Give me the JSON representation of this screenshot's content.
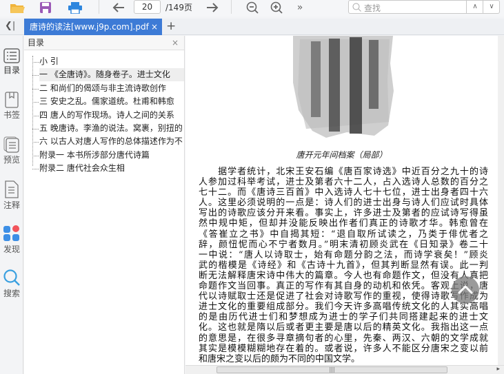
{
  "toolbar": {
    "page_current": "20",
    "page_total": "/149页",
    "search_placeholder": "查找",
    "more": "»"
  },
  "tab": {
    "title": "唐诗的读法[www.j9p.com].pdf",
    "close": "×",
    "new_tab": "+",
    "collapse": "❮|"
  },
  "leftbar": {
    "items": [
      {
        "label": "目录",
        "icon": "toc-icon"
      },
      {
        "label": "书签",
        "icon": "bookmark-icon"
      },
      {
        "label": "预览",
        "icon": "preview-icon"
      },
      {
        "label": "注释",
        "icon": "annotation-icon"
      },
      {
        "label": "发现",
        "icon": "discover-icon"
      },
      {
        "label": "搜索",
        "icon": "search-icon"
      }
    ]
  },
  "outline": {
    "title": "目录",
    "close": "×",
    "items": [
      "小 引",
      "一 《全唐诗》。随身卷子。进士文化",
      "二 和尚们的偈颂与非主流诗歌创作",
      "三 安史之乱。儒家道统。杜甫和韩愈",
      "四 唐人的写作现场。诗人之间的关系",
      "五 晚唐诗。李渔的说法。窝裹，别扭的",
      "六 以古人对唐人写作的总体描述作为不",
      "附录一 本书所涉部分唐代诗篇",
      "附录二 唐代社会众生相"
    ],
    "selected_index": 1
  },
  "document": {
    "caption": "唐开元年间档案（局部）",
    "lines": [
      "　　据学者统计，北宋王安石编《唐百家诗选》中近百分之九十的诗",
      "人参加过科举考试，进士及第者六十二人，占入选诗人总数的百分之",
      "七十二。而《唐诗三百首》中入选诗人七十七位，进士出身者四十六",
      "人。这里必须说明的一点是：诗人们的进士出身与诗人们应试时具体",
      "写出的诗歌应该分开来看。事实上，许多进士及第者的应试诗写得虽",
      "然中规中矩，但却并没能反映出作者们真正的诗歌才华。韩愈曾在",
      "《答崔立之书》中自揭其短：“退自取所试读之，乃类于俳优者之",
      "辞，颜忸怩而心不宁者数月。”明末清初顾炎武在《日知录》卷二十",
      "一中说：“唐人以诗取士，始有命题分韵之法，而诗学衰矣！”顾炎",
      "武的楷模是《诗经》和《古诗十九首》，但其判断显然有误。此一判",
      "断无法解释唐宋诗中伟大的篇章。今人也有命题作文，但没有人真把",
      "命题作文当回事。真正的写作有其自身的动机和依凭。客观上说，唐",
      "代以诗赋取士还是促进了社会对诗歌写作的重视，使得诗歌写作成为",
      "进士文化的重要组成部分。我们今天许多高唱传统文化的人其实高唱",
      "的是由历代进士们和梦想成为进士的学子们共同搭建起来的进士文",
      "化。这也就是隋以后或者更主要是唐以后的精英文化。我指出这一点",
      "的意思是，在很多寻章摘句者的心里，先秦、两汉、六朝的文学成就",
      "其实是模模糊糊地存在着的。或者说，许多人不能区分唐宋之变以前",
      "和唐宋之变以后的颇为不同的中国文学。"
    ]
  },
  "colors": {
    "tab_active": "#3d7bd6",
    "folder": "#f0b43c",
    "save": "#9b59b6",
    "print": "#2e86de"
  }
}
